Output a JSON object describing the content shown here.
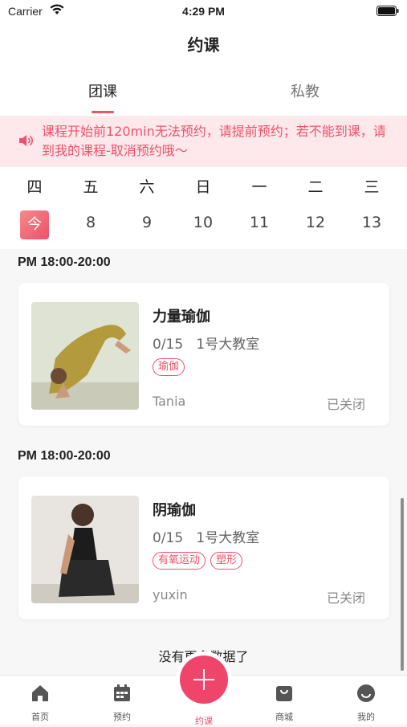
{
  "status_bar": {
    "carrier": "Carrier",
    "time": "4:29 PM"
  },
  "nav": {
    "title": "约课"
  },
  "tabs": [
    {
      "label": "团课"
    },
    {
      "label": "私教"
    }
  ],
  "notice": {
    "text": "课程开始前120min无法预约，请提前预约；若不能到课，请到我的课程-取消预约哦～"
  },
  "week": {
    "weekdays": [
      "四",
      "五",
      "六",
      "日",
      "一",
      "二",
      "三"
    ],
    "dates": [
      "今",
      "8",
      "9",
      "10",
      "11",
      "12",
      "13"
    ]
  },
  "sessions": [
    {
      "time": "PM 18:00-20:00",
      "name": "力量瑜伽",
      "capacity": "0/15",
      "room": "1号大教室",
      "tags": [
        "瑜伽"
      ],
      "coach": "Tania",
      "status": "已关闭"
    },
    {
      "time": "PM 18:00-20:00",
      "name": "阴瑜伽",
      "capacity": "0/15",
      "room": "1号大教室",
      "tags": [
        "有氧运动",
        "塑形"
      ],
      "coach": "yuxin",
      "status": "已关闭"
    }
  ],
  "list_footer": "没有更多数据了",
  "tabbar": [
    {
      "label": "首页",
      "icon": "home-icon"
    },
    {
      "label": "预约",
      "icon": "calendar-icon"
    },
    {
      "label": "约课",
      "icon": "plus-icon"
    },
    {
      "label": "商城",
      "icon": "shop-bag-icon"
    },
    {
      "label": "我的",
      "icon": "profile-icon"
    }
  ],
  "colors": {
    "accent": "#f2506a",
    "notice_bg": "#fde8eb"
  }
}
